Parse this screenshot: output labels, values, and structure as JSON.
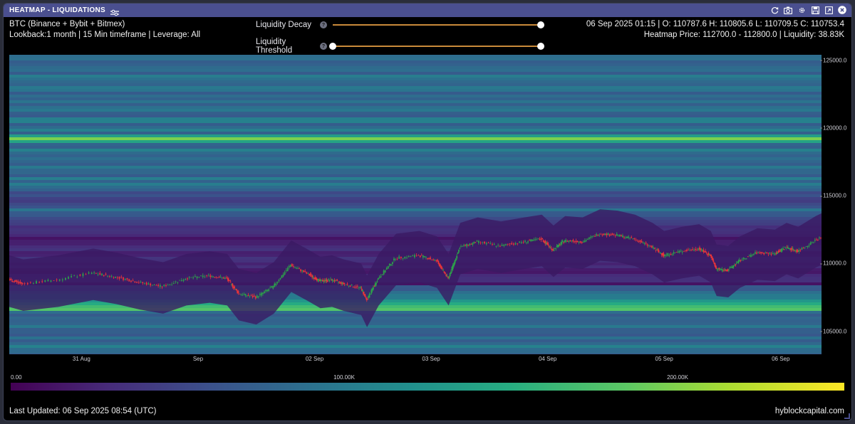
{
  "header": {
    "title": "HEATMAP - LIQUIDATIONS",
    "icons": [
      "refresh-icon",
      "camera-icon",
      "gear-icon",
      "save-icon",
      "expand-icon",
      "close-icon"
    ]
  },
  "info": {
    "exchange": "BTC (Binance + Bybit + Bitmex)",
    "lookback": "Lookback:1 month | 15 Min timeframe | Leverage: All",
    "ohlc": "06 Sep 2025 01:15 | O: 110787.6 H: 110805.6 L: 110709.5 C: 110753.4",
    "heatmap_price": "Heatmap Price: 112700.0 - 112800.0 | Liquidity: 38.83K"
  },
  "controls": {
    "decay_label": "Liquidity Decay",
    "decay_value": 1.0,
    "threshold_label": "Liquidity Threshold",
    "threshold_range": [
      0.0,
      1.0
    ],
    "help_glyph": "?"
  },
  "colors": {
    "accent": "#4a4f8f",
    "slider": "#c98a3a",
    "candle_up": "#2ca34a",
    "candle_down": "#e8353a"
  },
  "footer": {
    "updated": "Last Updated: 06 Sep 2025 08:54 (UTC)",
    "brand": "hyblockcapital.com"
  },
  "chart_data": {
    "type": "heatmap",
    "title": "HEATMAP - LIQUIDATIONS",
    "ylim": [
      103300,
      125400
    ],
    "yticks": [
      "105000.0",
      "110000.0",
      "115000.0",
      "120000.0",
      "125000.0"
    ],
    "ytick_values": [
      105000,
      110000,
      115000,
      120000,
      125000
    ],
    "xticks": [
      "31 Aug",
      "Sep",
      "02 Sep",
      "03 Sep",
      "04 Sep",
      "05 Sep",
      "06 Sep"
    ],
    "xtick_days": [
      0.5,
      1.5,
      2.5,
      3.5,
      4.5,
      5.5,
      6.5
    ],
    "x_range_days": [
      -0.12,
      6.85
    ],
    "colorbar": {
      "labels": [
        "0.00",
        "100.00K",
        "200.00K"
      ],
      "values": [
        0,
        100000,
        200000
      ],
      "max": 250000,
      "colormap": "viridis"
    },
    "bright_bands": [
      {
        "price": 119300,
        "intensity": 0.88
      },
      {
        "price": 121500,
        "intensity": 0.55
      },
      {
        "price": 114000,
        "intensity": 0.5
      },
      {
        "price": 107200,
        "intensity": 0.75
      },
      {
        "price": 106800,
        "intensity": 0.9
      },
      {
        "price": 104000,
        "intensity": 0.5
      },
      {
        "price": 105600,
        "intensity": 0.4
      },
      {
        "price": 124000,
        "intensity": 0.45
      }
    ],
    "price_path": [
      {
        "day": -0.12,
        "price": 108800
      },
      {
        "day": 0.0,
        "price": 108500
      },
      {
        "day": 0.3,
        "price": 108800
      },
      {
        "day": 0.6,
        "price": 109300
      },
      {
        "day": 0.8,
        "price": 109000
      },
      {
        "day": 1.0,
        "price": 108600
      },
      {
        "day": 1.2,
        "price": 108300
      },
      {
        "day": 1.4,
        "price": 108900
      },
      {
        "day": 1.6,
        "price": 109100
      },
      {
        "day": 1.75,
        "price": 108900
      },
      {
        "day": 1.85,
        "price": 107800
      },
      {
        "day": 2.0,
        "price": 107500
      },
      {
        "day": 2.15,
        "price": 108300
      },
      {
        "day": 2.3,
        "price": 109900
      },
      {
        "day": 2.45,
        "price": 109200
      },
      {
        "day": 2.55,
        "price": 108700
      },
      {
        "day": 2.65,
        "price": 108800
      },
      {
        "day": 2.75,
        "price": 108500
      },
      {
        "day": 2.9,
        "price": 108200
      },
      {
        "day": 2.95,
        "price": 107300
      },
      {
        "day": 3.05,
        "price": 108900
      },
      {
        "day": 3.2,
        "price": 110400
      },
      {
        "day": 3.4,
        "price": 110600
      },
      {
        "day": 3.55,
        "price": 110200
      },
      {
        "day": 3.65,
        "price": 108900
      },
      {
        "day": 3.75,
        "price": 111200
      },
      {
        "day": 3.9,
        "price": 111600
      },
      {
        "day": 4.1,
        "price": 111300
      },
      {
        "day": 4.3,
        "price": 111600
      },
      {
        "day": 4.45,
        "price": 111800
      },
      {
        "day": 4.55,
        "price": 111000
      },
      {
        "day": 4.65,
        "price": 111700
      },
      {
        "day": 4.8,
        "price": 111600
      },
      {
        "day": 4.95,
        "price": 112200
      },
      {
        "day": 5.1,
        "price": 112100
      },
      {
        "day": 5.25,
        "price": 111800
      },
      {
        "day": 5.4,
        "price": 111200
      },
      {
        "day": 5.5,
        "price": 110600
      },
      {
        "day": 5.65,
        "price": 110900
      },
      {
        "day": 5.8,
        "price": 111100
      },
      {
        "day": 5.9,
        "price": 110600
      },
      {
        "day": 5.95,
        "price": 109600
      },
      {
        "day": 6.05,
        "price": 109500
      },
      {
        "day": 6.15,
        "price": 110200
      },
      {
        "day": 6.3,
        "price": 110800
      },
      {
        "day": 6.45,
        "price": 110700
      },
      {
        "day": 6.55,
        "price": 111200
      },
      {
        "day": 6.65,
        "price": 110900
      },
      {
        "day": 6.8,
        "price": 111700
      },
      {
        "day": 6.95,
        "price": 112300
      },
      {
        "day": 7.05,
        "price": 113000
      },
      {
        "day": 7.12,
        "price": 112200
      },
      {
        "day": 7.18,
        "price": 110900
      },
      {
        "day": 7.25,
        "price": 110400
      },
      {
        "day": 7.4,
        "price": 110700
      },
      {
        "day": 7.55,
        "price": 110400
      },
      {
        "day": 7.7,
        "price": 110700
      },
      {
        "day": 7.9,
        "price": 110800
      }
    ]
  }
}
